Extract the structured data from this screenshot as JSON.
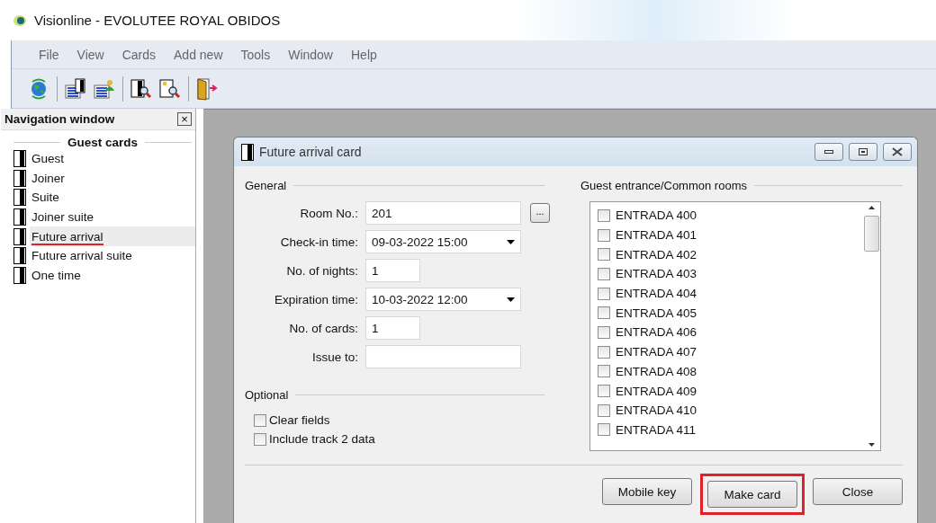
{
  "window": {
    "title": "Visionline - EVOLUTEE ROYAL OBIDOS"
  },
  "menu": [
    "File",
    "View",
    "Cards",
    "Add new",
    "Tools",
    "Window",
    "Help"
  ],
  "toolbar": [
    {
      "kind": "globe"
    },
    {
      "kind": "sep"
    },
    {
      "kind": "card-list"
    },
    {
      "kind": "card-person"
    },
    {
      "kind": "sep"
    },
    {
      "kind": "card-search"
    },
    {
      "kind": "doc-search"
    },
    {
      "kind": "sep"
    },
    {
      "kind": "exit"
    }
  ],
  "navigation": {
    "title": "Navigation window",
    "close": "×",
    "section": "Guest cards",
    "items": [
      {
        "label": "Guest",
        "selected": false,
        "highlighted": false
      },
      {
        "label": "Joiner",
        "selected": false,
        "highlighted": false
      },
      {
        "label": "Suite",
        "selected": false,
        "highlighted": false
      },
      {
        "label": "Joiner suite",
        "selected": false,
        "highlighted": false
      },
      {
        "label": "Future arrival",
        "selected": true,
        "highlighted": true
      },
      {
        "label": "Future arrival suite",
        "selected": false,
        "highlighted": false
      },
      {
        "label": "One time",
        "selected": false,
        "highlighted": false
      }
    ]
  },
  "dialog": {
    "title": "Future arrival card",
    "general": {
      "title": "General",
      "fields": [
        {
          "label": "Room No.:",
          "kind": "text",
          "value": "201",
          "browse": "..."
        },
        {
          "label": "Check-in time:",
          "kind": "date",
          "value": "09-03-2022 15:00"
        },
        {
          "label": "No. of nights:",
          "kind": "short",
          "value": "1"
        },
        {
          "label": "Expiration time:",
          "kind": "date",
          "value": "10-03-2022 12:00"
        },
        {
          "label": "No. of cards:",
          "kind": "short",
          "value": "1"
        },
        {
          "label": "Issue to:",
          "kind": "text"
        }
      ]
    },
    "optional": {
      "title": "Optional",
      "options": [
        {
          "label": "Clear fields",
          "checked": false
        },
        {
          "label": "Include track 2 data",
          "checked": false
        }
      ]
    },
    "rooms": {
      "title": "Guest entrance/Common rooms",
      "items": [
        {
          "label": "ENTRADA 400",
          "checked": false
        },
        {
          "label": "ENTRADA 401",
          "checked": false
        },
        {
          "label": "ENTRADA 402",
          "checked": false
        },
        {
          "label": "ENTRADA 403",
          "checked": false
        },
        {
          "label": "ENTRADA 404",
          "checked": false
        },
        {
          "label": "ENTRADA 405",
          "checked": false
        },
        {
          "label": "ENTRADA 406",
          "checked": false
        },
        {
          "label": "ENTRADA 407",
          "checked": false
        },
        {
          "label": "ENTRADA 408",
          "checked": false
        },
        {
          "label": "ENTRADA 409",
          "checked": false
        },
        {
          "label": "ENTRADA 410",
          "checked": false
        },
        {
          "label": "ENTRADA 411",
          "checked": false
        }
      ]
    },
    "buttons": [
      {
        "label": "Mobile key",
        "highlighted": false
      },
      {
        "label": "Make card",
        "highlighted": true
      },
      {
        "label": "Close",
        "highlighted": false
      }
    ]
  }
}
